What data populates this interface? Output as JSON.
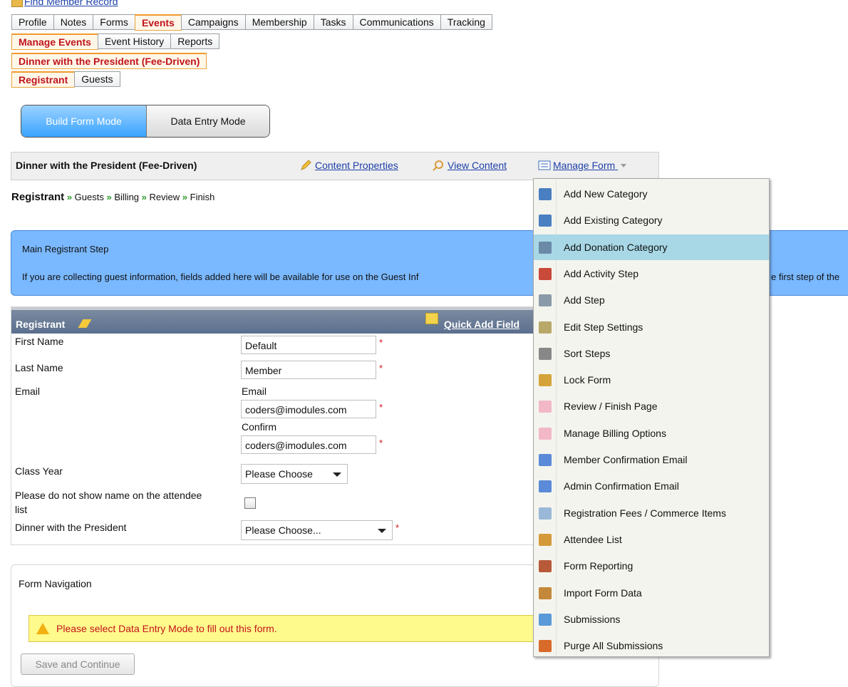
{
  "top_link": {
    "label": "Find Member Record"
  },
  "main_tabs": [
    "Profile",
    "Notes",
    "Forms",
    "Events",
    "Campaigns",
    "Membership",
    "Tasks",
    "Communications",
    "Tracking"
  ],
  "sub_tabs": [
    "Manage Events",
    "Event History",
    "Reports"
  ],
  "event_tab": "Dinner with the President (Fee-Driven)",
  "reg_tabs": [
    "Registrant",
    "Guests"
  ],
  "mode": {
    "build": "Build Form Mode",
    "entry": "Data Entry Mode"
  },
  "header": {
    "title": "Dinner with the President (Fee-Driven)",
    "content_properties": "Content Properties",
    "view_content": "View Content",
    "manage_form": "Manage Form"
  },
  "breadcrumb": {
    "current": "Registrant",
    "steps": [
      "Guests",
      "Billing",
      "Review",
      "Finish"
    ],
    "sep": "»"
  },
  "info": {
    "title": "Main Registrant Step",
    "text": "If you are collecting guest information, fields added here will be available for use on the Guest Inf",
    "text_tail": "e first step of the"
  },
  "registrant": {
    "title": "Registrant",
    "quick_add": "Quick Add Field",
    "first_name_label": "First Name",
    "first_name_value": "Default",
    "last_name_label": "Last Name",
    "last_name_value": "Member",
    "email_label": "Email",
    "email_sub_label": "Email",
    "email_value": "coders@imodules.com",
    "confirm_label": "Confirm",
    "confirm_value": "coders@imodules.com",
    "class_year_label": "Class Year",
    "class_year_value": "Please Choose",
    "no_show_label_1": "Please do not show name on the attendee",
    "no_show_label_2": "list",
    "dinner_label": "Dinner with the President",
    "dinner_value": "Please Choose...",
    "required_mark": "*"
  },
  "form_nav": {
    "title": "Form Navigation",
    "warning": "Please select Data Entry Mode to fill out this form.",
    "save_button": "Save and Continue"
  },
  "menu": {
    "items": [
      {
        "label": "Add New Category",
        "icon": "add-category-icon",
        "color": "#4a7fc1"
      },
      {
        "label": "Add Existing Category",
        "icon": "existing-category-icon",
        "color": "#4a7fc1"
      },
      {
        "label": "Add Donation Category",
        "icon": "donation-icon",
        "color": "#6a8aa8"
      },
      {
        "label": "Add Activity Step",
        "icon": "activity-icon",
        "color": "#c94a3a"
      },
      {
        "label": "Add Step",
        "icon": "step-icon",
        "color": "#8a9aa8"
      },
      {
        "label": "Edit Step Settings",
        "icon": "edit-step-icon",
        "color": "#b8a86a"
      },
      {
        "label": "Sort Steps",
        "icon": "sort-icon",
        "color": "#888888"
      },
      {
        "label": "Lock Form",
        "icon": "lock-icon",
        "color": "#d4a43a"
      },
      {
        "label": "Review / Finish Page",
        "icon": "review-icon",
        "color": "#f2b8c8"
      },
      {
        "label": "Manage Billing Options",
        "icon": "billing-icon",
        "color": "#f2b8c8"
      },
      {
        "label": "Member Confirmation Email",
        "icon": "email-icon",
        "color": "#5a8ad8"
      },
      {
        "label": "Admin Confirmation Email",
        "icon": "admin-email-icon",
        "color": "#5a8ad8"
      },
      {
        "label": "Registration Fees / Commerce Items",
        "icon": "fees-icon",
        "color": "#9ab8d8"
      },
      {
        "label": "Attendee List",
        "icon": "attendee-icon",
        "color": "#d49a3a"
      },
      {
        "label": "Form Reporting",
        "icon": "reporting-icon",
        "color": "#b85a3a"
      },
      {
        "label": "Import Form Data",
        "icon": "import-icon",
        "color": "#c4883a"
      },
      {
        "label": "Submissions",
        "icon": "submissions-icon",
        "color": "#5a9ad8"
      },
      {
        "label": "Purge All Submissions",
        "icon": "purge-icon",
        "color": "#d86a2a"
      }
    ],
    "highlighted_index": 2
  }
}
